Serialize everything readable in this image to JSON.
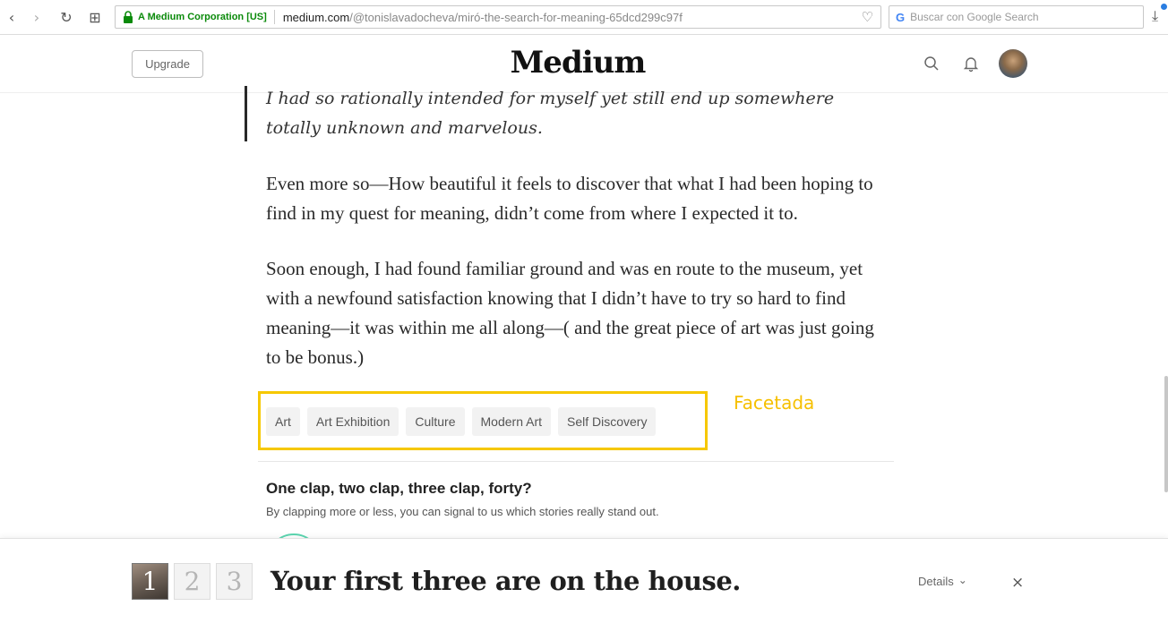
{
  "browser": {
    "back_glyph": "‹",
    "forward_glyph": "›",
    "reload_glyph": "↻",
    "apps_glyph": "⊞",
    "secure_label": "A Medium Corporation [US]",
    "url_host": "medium.com",
    "url_path": "/@tonislavadocheva/miró-the-search-for-meaning-65dcd299c97f",
    "bookmark_glyph": "♡",
    "search_placeholder": "Buscar con Google Search",
    "google_glyph": "G",
    "download_glyph": "⤓"
  },
  "header": {
    "upgrade_label": "Upgrade",
    "logo": "Medium"
  },
  "article": {
    "quote": "I had so rationally intended for myself yet still end up somewhere totally unknown and marvelous.",
    "paragraph_1": "Even more so—How beautiful it feels to discover that what I had been hoping to find in my quest for meaning, didn’t come from where I expected it to.",
    "paragraph_2": "Soon enough, I had found familiar ground and was en route to the museum, yet with a newfound satisfaction knowing that I didn’t have to try so hard to find meaning—it was within me all along—( and the great piece of art was just going to be bonus.)",
    "tags": [
      "Art",
      "Art Exhibition",
      "Culture",
      "Modern Art",
      "Self Discovery"
    ],
    "annotation": "Facetada",
    "clap_title": "One clap, two clap, three clap, forty?",
    "clap_subtitle": "By clapping more or less, you can signal to us which stories really stand out."
  },
  "banner": {
    "numbers": [
      "1",
      "2",
      "3"
    ],
    "title": "Your first three are on the house.",
    "details_label": "Details",
    "details_glyph": "⌄",
    "close_glyph": "×"
  },
  "colors": {
    "annotation": "#f6c800",
    "secure": "#0a8a0a",
    "clap_accent": "#5cd6b0"
  }
}
